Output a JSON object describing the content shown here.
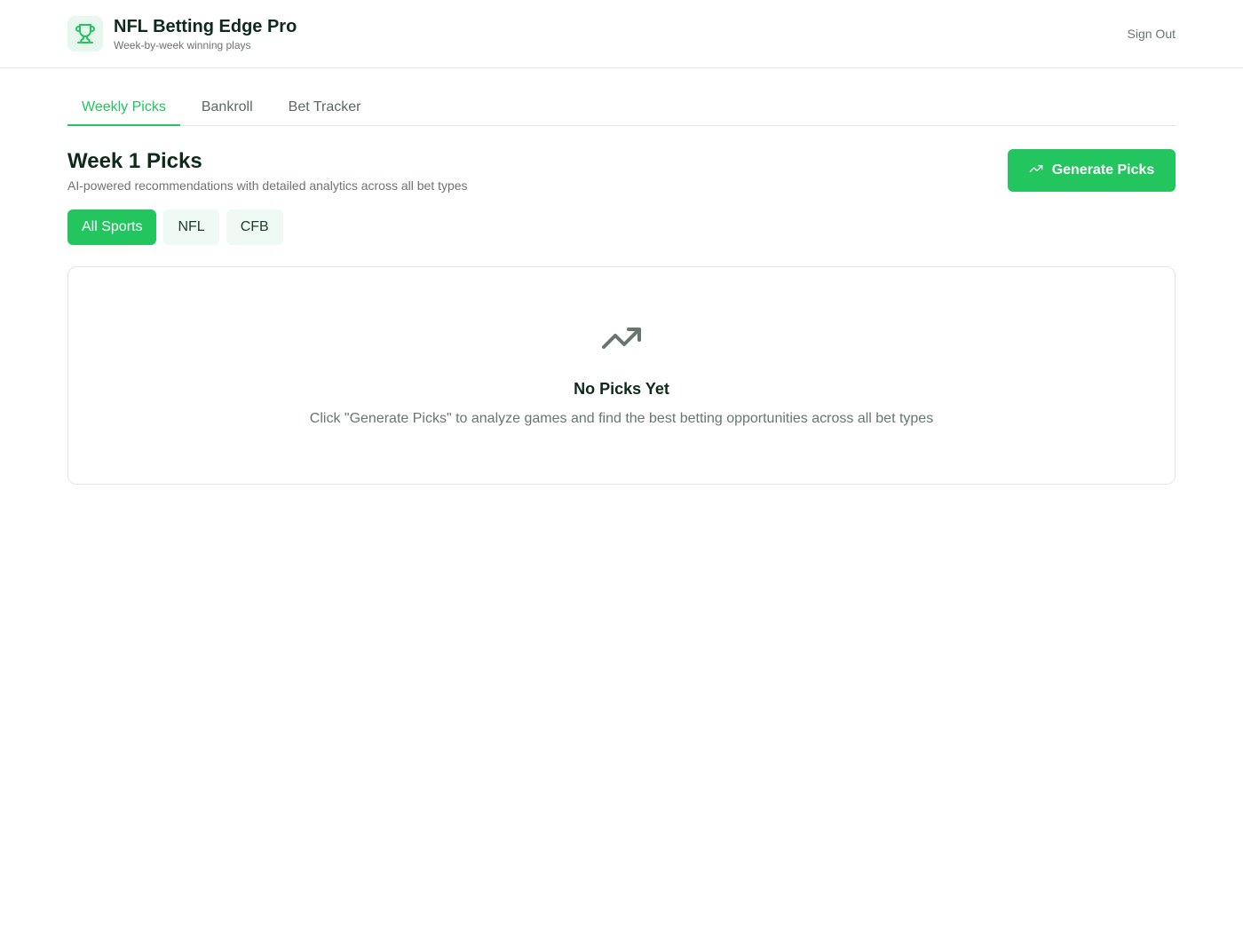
{
  "header": {
    "title": "NFL Betting Edge Pro",
    "subtitle": "Week-by-week winning plays",
    "logo_icon": "trophy-icon",
    "sign_out": "Sign Out"
  },
  "tabs": [
    {
      "label": "Weekly Picks",
      "active": true
    },
    {
      "label": "Bankroll",
      "active": false
    },
    {
      "label": "Bet Tracker",
      "active": false
    }
  ],
  "section": {
    "title": "Week 1 Picks",
    "subtitle": "AI-powered recommendations with detailed analytics across all bet types",
    "generate_label": "Generate Picks",
    "generate_icon": "trending-up-icon"
  },
  "filters": [
    {
      "label": "All Sports",
      "active": true
    },
    {
      "label": "NFL",
      "active": false
    },
    {
      "label": "CFB",
      "active": false
    }
  ],
  "empty_state": {
    "icon": "trending-up-icon",
    "title": "No Picks Yet",
    "description": "Click \"Generate Picks\" to analyze games and find the best betting opportunities across all bet types"
  },
  "colors": {
    "accent": "#22c55e",
    "accent_light": "#e8f7ee",
    "text_dark": "#0d2a1a",
    "text_muted": "#6b7570"
  }
}
